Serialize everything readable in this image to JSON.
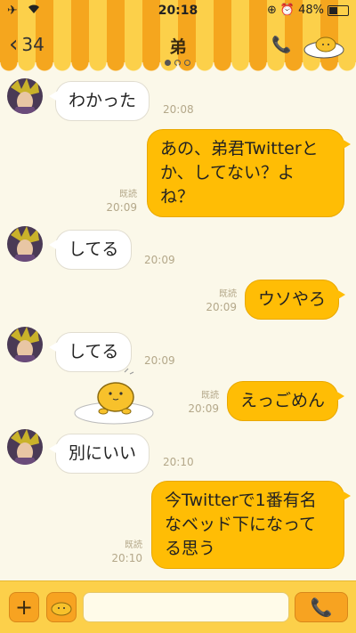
{
  "status_bar": {
    "time": "20:18",
    "battery": "48%"
  },
  "header": {
    "back_count": "34",
    "title": "弟"
  },
  "messages": [
    {
      "side": "in",
      "text": "わかった",
      "time": "20:08"
    },
    {
      "side": "out",
      "text_lines": [
        "あの、弟君Twitterと",
        "か、してない？よ",
        "ね？"
      ],
      "read": "既読",
      "time": "20:09"
    },
    {
      "side": "in",
      "text": "してる",
      "time": "20:09"
    },
    {
      "side": "out",
      "text": "ウソやろ",
      "read": "既読",
      "time": "20:09"
    },
    {
      "side": "in",
      "text": "してる",
      "time": "20:09"
    },
    {
      "side": "out",
      "text": "えっごめん",
      "read": "既読",
      "time": "20:09"
    },
    {
      "side": "in",
      "text": "別にいい",
      "time": "20:10"
    },
    {
      "side": "out",
      "text_lines": [
        "今Twitterで1番有名",
        "なベッド下になって",
        "る思う"
      ],
      "read": "既読",
      "time": "20:10"
    }
  ],
  "colors": {
    "header_orange": "#f5a61e",
    "header_yellow": "#fcd04a",
    "bubble_out": "#ffbd05",
    "bg": "#fbf8e9"
  }
}
